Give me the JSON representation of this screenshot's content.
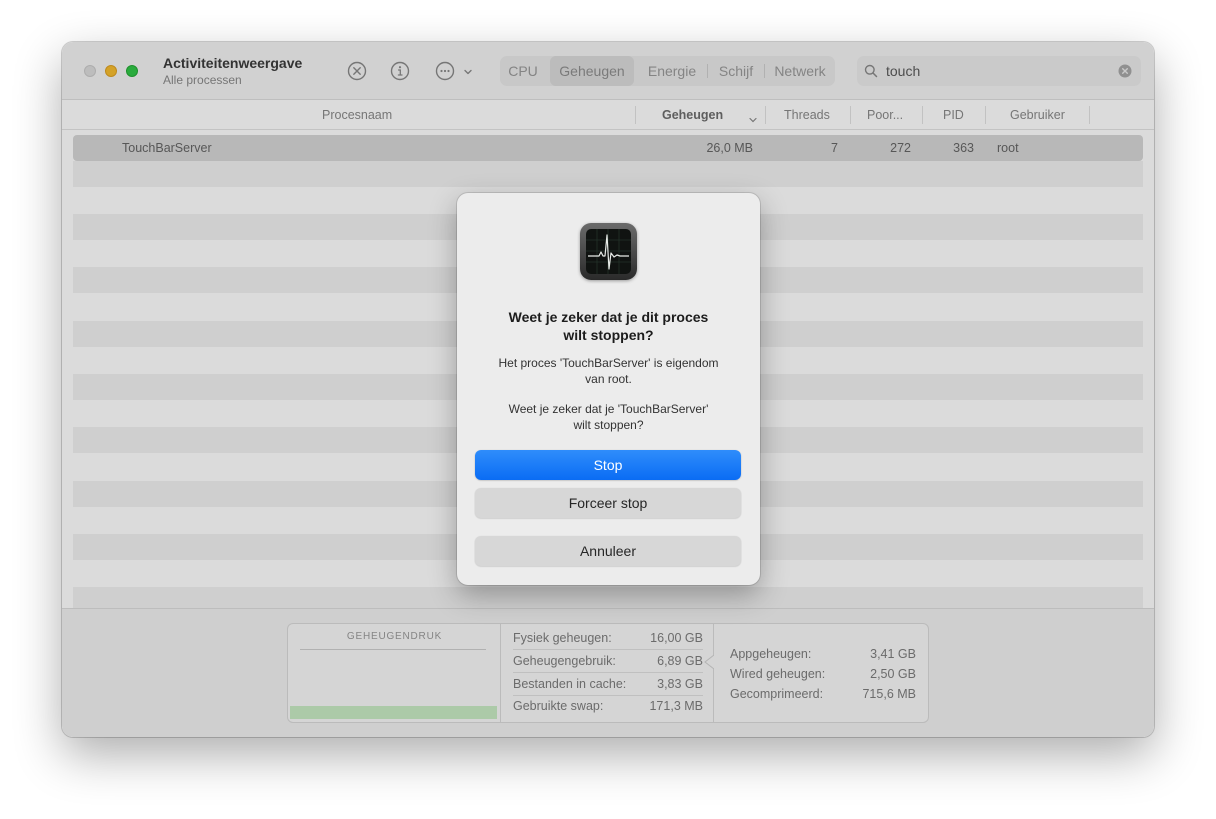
{
  "window": {
    "title": "Activiteitenweergave",
    "subtitle": "Alle processen"
  },
  "toolbar": {
    "icons": [
      "stop-process-icon",
      "info-icon",
      "more-options-icon",
      "chevron-down-icon"
    ],
    "tabs": [
      {
        "label": "CPU",
        "active": false
      },
      {
        "label": "Geheugen",
        "active": true
      },
      {
        "label": "Energie",
        "active": false
      },
      {
        "label": "Schijf",
        "active": false
      },
      {
        "label": "Netwerk",
        "active": false
      }
    ]
  },
  "search": {
    "value": "touch"
  },
  "table": {
    "columns": {
      "name": "Procesnaam",
      "memory": "Geheugen",
      "threads": "Threads",
      "ports": "Poor...",
      "pid": "PID",
      "user": "Gebruiker"
    },
    "sorted_by": "Geheugen",
    "rows": [
      {
        "name": "TouchBarServer",
        "memory": "26,0 MB",
        "threads": "7",
        "ports": "272",
        "pid": "363",
        "user": "root"
      }
    ]
  },
  "footer": {
    "pressure_title": "GEHEUGENDRUK",
    "pressure_color": "#c9ecc4",
    "left_stats": [
      {
        "label": "Fysiek geheugen:",
        "value": "16,00 GB"
      },
      {
        "label": "Geheugengebruik:",
        "value": "6,89 GB"
      },
      {
        "label": "Bestanden in cache:",
        "value": "3,83 GB"
      },
      {
        "label": "Gebruikte swap:",
        "value": "171,3 MB"
      }
    ],
    "right_stats": [
      {
        "label": "Appgeheugen:",
        "value": "3,41 GB"
      },
      {
        "label": "Wired geheugen:",
        "value": "2,50 GB"
      },
      {
        "label": "Gecomprimeerd:",
        "value": "715,6 MB"
      }
    ]
  },
  "dialog": {
    "icon": "activity-monitor-app-icon",
    "title_line1": "Weet je zeker dat je dit proces",
    "title_line2": "wilt stoppen?",
    "message1_line1": "Het proces 'TouchBarServer' is eigendom",
    "message1_line2": "van root.",
    "message2_line1": "Weet je zeker dat je 'TouchBarServer'",
    "message2_line2": "wilt stoppen?",
    "stop_label": "Stop",
    "force_stop_label": "Forceer stop",
    "cancel_label": "Annuleer",
    "accent_color": "#0a6cf4"
  }
}
